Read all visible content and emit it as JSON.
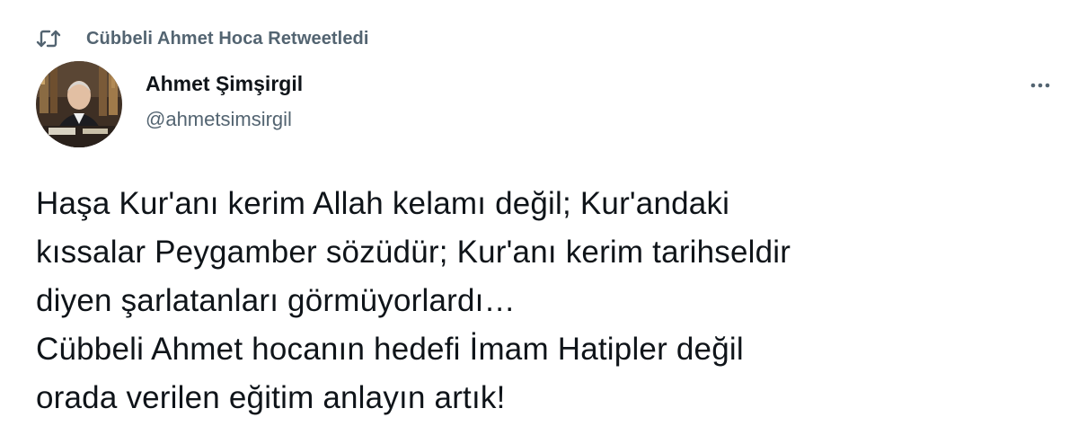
{
  "retweet": {
    "icon": "retweet-icon",
    "label": "Cübbeli Ahmet Hoca Retweetledi"
  },
  "author": {
    "avatar": "avatar",
    "display_name": "Ahmet Şimşirgil",
    "handle": "@ahmetsimsirgil"
  },
  "menu": {
    "icon": "more-icon"
  },
  "tweet": {
    "lines": [
      "Haşa Kur'anı kerim Allah kelamı değil; Kur'andaki",
      "kıssalar Peygamber sözüdür; Kur'anı kerim tarihseldir",
      "diyen şarlatanları görmüyorlardı…",
      "Cübbeli Ahmet hocanın hedefi İmam Hatipler değil",
      "orada verilen eğitim anlayın artık!"
    ]
  },
  "colors": {
    "text_primary": "#0f1419",
    "text_secondary": "#536471",
    "background": "#ffffff"
  }
}
